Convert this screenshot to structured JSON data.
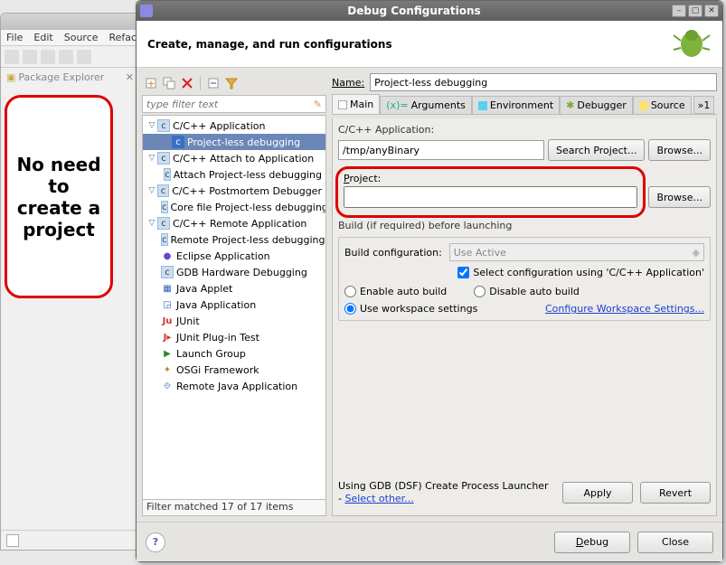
{
  "bg_menu": {
    "file": "File",
    "edit": "Edit",
    "source": "Source",
    "refact": "Refact"
  },
  "pkg_explorer_tab": "Package Explorer",
  "callout": "No need to create a project",
  "dialog_title": "Debug Configurations",
  "header": "Create, manage, and run configurations",
  "filter_placeholder": "type filter text",
  "tree": {
    "n0": "C/C++ Application",
    "n0c": "Project-less debugging",
    "n1": "C/C++ Attach to Application",
    "n1c": "Attach Project-less debugging",
    "n2": "C/C++ Postmortem Debugger",
    "n2c": "Core file Project-less debugging",
    "n3": "C/C++ Remote Application",
    "n3c": "Remote Project-less debugging",
    "n4": "Eclipse Application",
    "n5": "GDB Hardware Debugging",
    "n6": "Java Applet",
    "n7": "Java Application",
    "n8": "JUnit",
    "n9": "JUnit Plug-in Test",
    "n10": "Launch Group",
    "n11": "OSGi Framework",
    "n12": "Remote Java Application"
  },
  "filter_status": "Filter matched 17 of 17 items",
  "name_label": "Name:",
  "name_value": "Project-less debugging",
  "tabs": {
    "main": "Main",
    "args": "Arguments",
    "env": "Environment",
    "dbg": "Debugger",
    "src": "Source",
    "overflow": "»1"
  },
  "app_label": "C/C++ Application:",
  "app_value": "/tmp/anyBinary",
  "btn_search_proj": "Search Project...",
  "btn_browse": "Browse...",
  "proj_label": "Project:",
  "proj_value": "",
  "build_heading": "Build (if required) before launching",
  "build_cfg_label": "Build configuration:",
  "build_cfg_value": "Use Active",
  "select_cfg_chk": "Select configuration using 'C/C++ Application'",
  "radio_enable": "Enable auto build",
  "radio_disable": "Disable auto build",
  "radio_workspace": "Use workspace settings",
  "cfg_ws_link": "Configure Workspace Settings...",
  "launcher_prefix": "Using GDB (DSF) Create Process Launcher - ",
  "launcher_link": "Select other...",
  "btn_apply": "Apply",
  "btn_revert": "Revert",
  "btn_debug": "Debug",
  "btn_close": "Close"
}
